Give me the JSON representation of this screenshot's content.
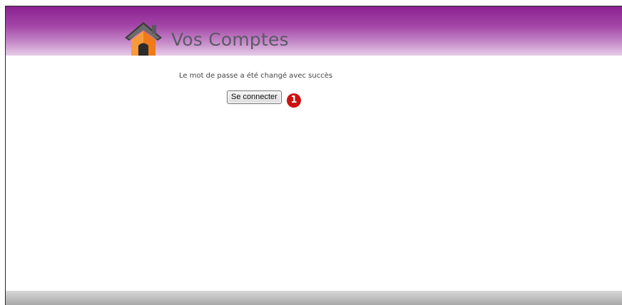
{
  "header": {
    "title": "Vos Comptes",
    "logo_icon": "house-icon",
    "gradient_colors": [
      "#8a2090",
      "#e6cde8"
    ]
  },
  "main": {
    "message": "Le mot de passe a été changé avec succès",
    "login_button_label": "Se connecter",
    "marker_number": "1",
    "marker_color": "#cc1111"
  }
}
